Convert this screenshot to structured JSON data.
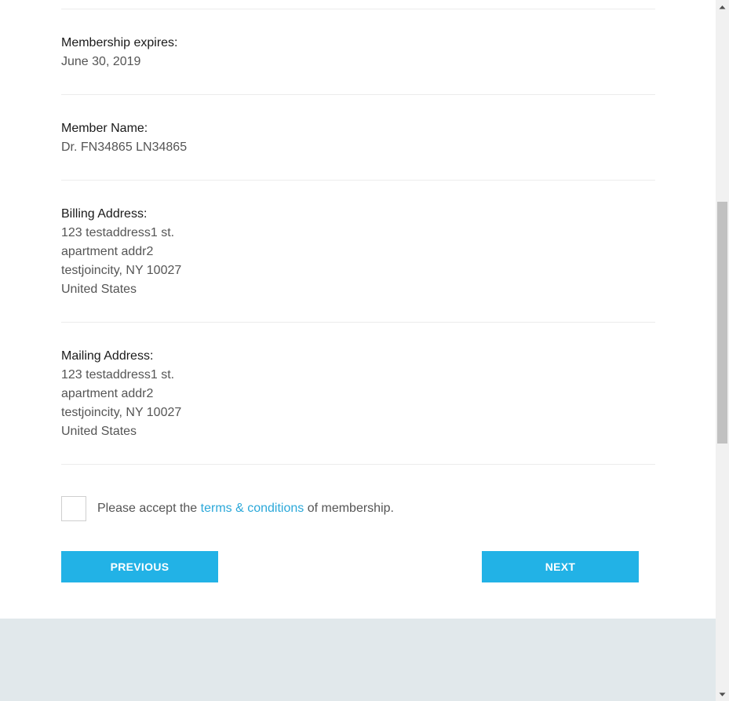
{
  "sections": [
    {
      "label": "Membership expires:",
      "lines": [
        "June 30, 2019"
      ]
    },
    {
      "label": "Member Name:",
      "lines": [
        "Dr. FN34865 LN34865"
      ]
    },
    {
      "label": "Billing Address:",
      "lines": [
        "123 testaddress1 st.",
        "apartment addr2",
        "testjoincity, NY 10027",
        "United States"
      ]
    },
    {
      "label": "Mailing Address:",
      "lines": [
        "123 testaddress1 st.",
        "apartment addr2",
        "testjoincity, NY 10027",
        "United States"
      ]
    }
  ],
  "terms": {
    "prefix": "Please accept the ",
    "link": "terms & conditions",
    "suffix": " of membership.",
    "checked": false
  },
  "buttons": {
    "previous": "PREVIOUS",
    "next": "NEXT"
  },
  "colors": {
    "accent": "#22b2e6",
    "link": "#2ba8d9",
    "footer": "#e1e8eb"
  }
}
